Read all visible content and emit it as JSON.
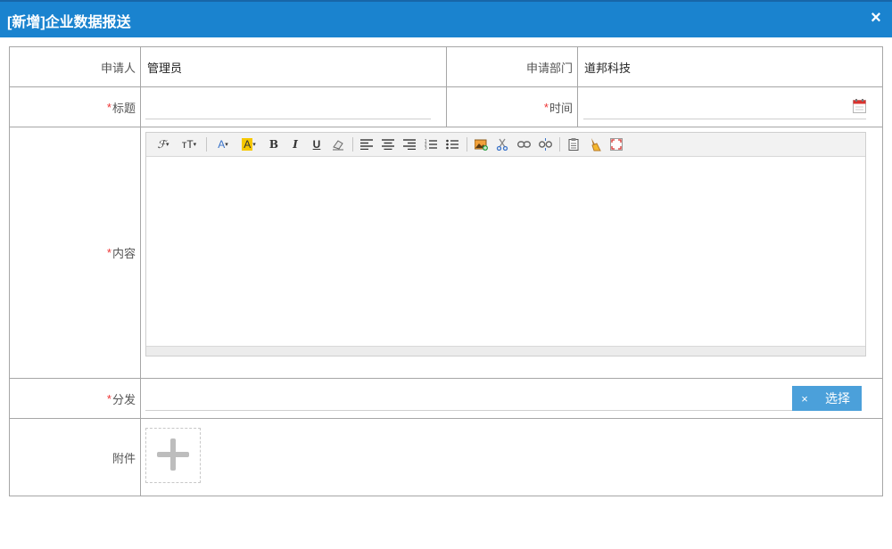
{
  "dialog": {
    "title": "[新增]企业数据报送",
    "close_glyph": "×"
  },
  "form": {
    "applicant_label": "申请人",
    "applicant_value": "管理员",
    "department_label": "申请部门",
    "department_value": "道邦科技",
    "required_mark": "*",
    "title_label": "标题",
    "title_value": "",
    "time_label": "时间",
    "time_value": "",
    "content_label": "内容",
    "distribute_label": "分发",
    "distribute_value": "",
    "clear_glyph": "×",
    "select_label": "选择",
    "attachment_label": "附件"
  },
  "toolbar": {
    "font_family": "ℱ",
    "font_size": "ᴛT",
    "font_color": "A",
    "highlight": "A",
    "bold": "B",
    "italic": "I",
    "underline": "U"
  },
  "colors": {
    "titlebar": "#1a83cf",
    "accent_button": "#4ba0da",
    "required": "#ee3333",
    "border": "#a6a6a6"
  }
}
